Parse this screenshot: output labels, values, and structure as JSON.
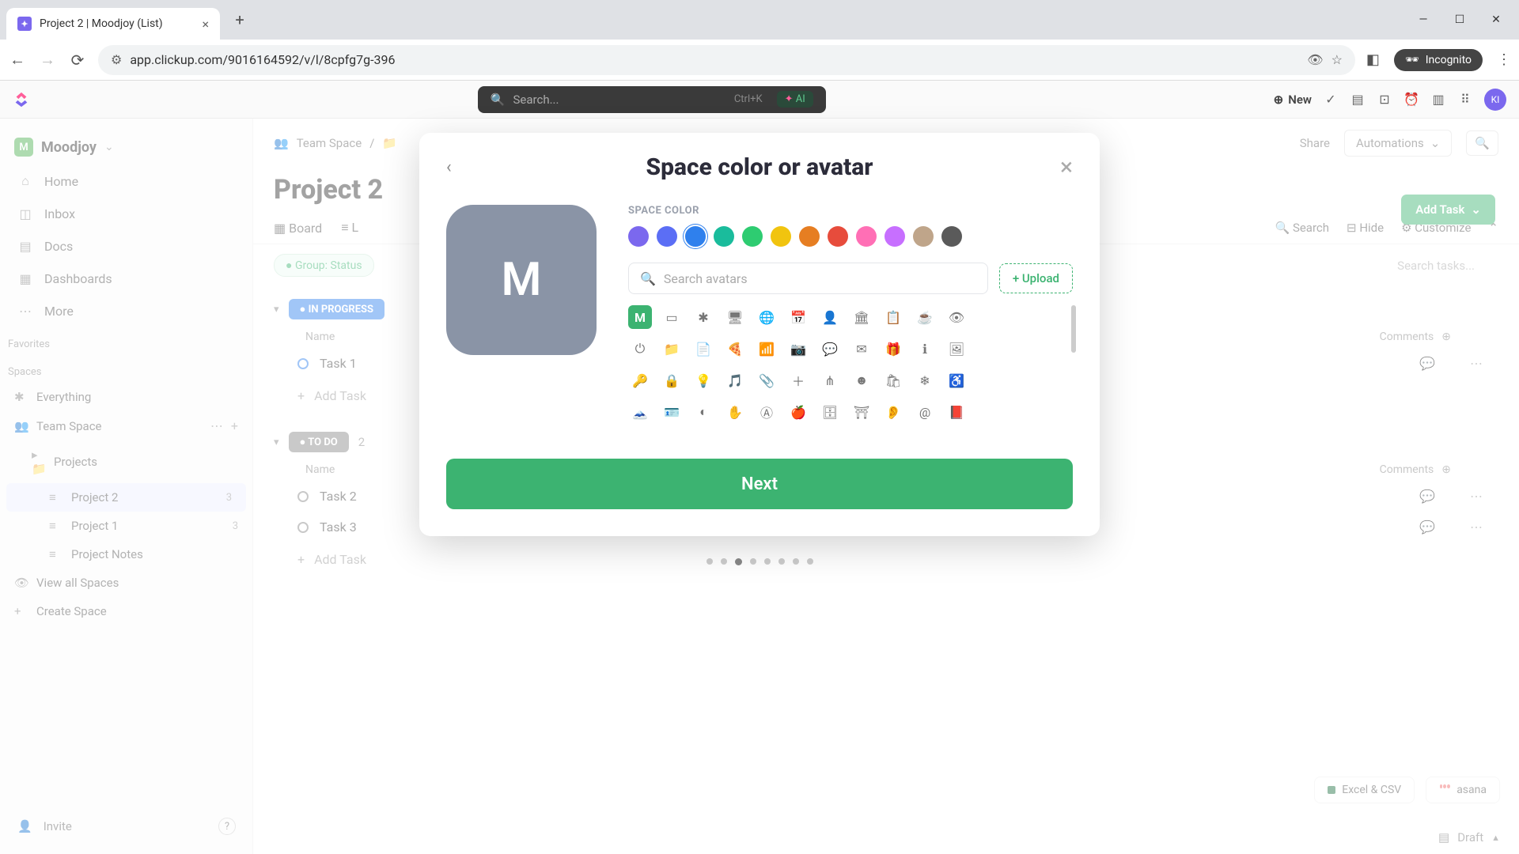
{
  "browser": {
    "tab_title": "Project 2 | Moodjoy (List)",
    "url": "app.clickup.com/9016164592/v/l/8cpfg7g-396",
    "incognito": "Incognito"
  },
  "topbar": {
    "search_placeholder": "Search...",
    "search_hint": "Ctrl+K",
    "ai_label": "AI",
    "new_label": "New"
  },
  "sidebar": {
    "workspace_letter": "M",
    "workspace_name": "Moodjoy",
    "nav": {
      "home": "Home",
      "inbox": "Inbox",
      "docs": "Docs",
      "dashboards": "Dashboards",
      "more": "More"
    },
    "favorites_label": "Favorites",
    "spaces_label": "Spaces",
    "everything": "Everything",
    "team_space": "Team Space",
    "projects": "Projects",
    "project2": "Project 2",
    "project2_count": "3",
    "project1": "Project 1",
    "project1_count": "3",
    "project_notes": "Project Notes",
    "view_all": "View all Spaces",
    "create_space": "Create Space",
    "invite": "Invite"
  },
  "main": {
    "breadcrumb_team": "Team Space",
    "title": "Project 2",
    "share": "Share",
    "automations": "Automations",
    "add_task": "Add Task",
    "tab_board": "Board",
    "tab_list_prefix": "L",
    "search": "Search",
    "hide": "Hide",
    "customize": "Customize",
    "group_chip": "Group: Status",
    "search_tasks_placeholder": "Search tasks...",
    "in_progress": "IN PROGRESS",
    "to_do": "TO DO",
    "to_do_count": "2",
    "col_name": "Name",
    "col_comments": "Comments",
    "task1": "Task 1",
    "task2": "Task 2",
    "task3": "Task 3",
    "add_task_row": "Add Task",
    "excel": "Excel & CSV",
    "asana": "asana",
    "draft": "Draft"
  },
  "modal": {
    "title": "Space color or avatar",
    "avatar_letter": "M",
    "label": "SPACE COLOR",
    "colors": [
      "#7b68ee",
      "#5b6ef5",
      "#2f80ed",
      "#1abc9c",
      "#2ecc71",
      "#f1c40f",
      "#e67e22",
      "#e74c3c",
      "#ff6fb5",
      "#c76fff",
      "#bfa58a",
      "#5a5a5a"
    ],
    "selected_color_index": 2,
    "search_placeholder": "Search avatars",
    "upload": "+ Upload",
    "next": "Next",
    "step_count": 8,
    "step_active": 2,
    "icons": [
      "M",
      "▭",
      "✱",
      "🖥",
      "🌐",
      "📅",
      "👤",
      "🏛",
      "📋",
      "☕",
      "👁",
      "⏻",
      "📁",
      "📄",
      "🍕",
      "📶",
      "📷",
      "💬",
      "✉",
      "🎁",
      "ℹ",
      "🖼",
      "🔑",
      "🔒",
      "💡",
      "🎵",
      "📎",
      "＋",
      "⋔",
      "☻",
      "🛍",
      "❄",
      "♿",
      "🗻",
      "🪪",
      "◐",
      "✋",
      "Ⓐ",
      "🍎",
      "🗄",
      "⛩",
      "👂",
      "@",
      "📕"
    ]
  }
}
